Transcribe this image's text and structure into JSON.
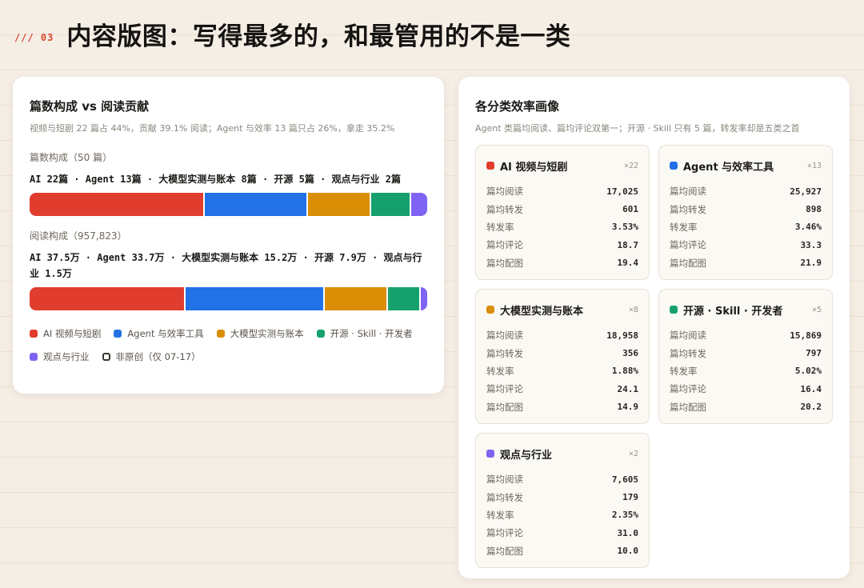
{
  "header": {
    "section_tag": "/// 03",
    "title": "内容版图：写得最多的，和最管用的不是一类"
  },
  "left_card": {
    "title": "篇数构成 vs 阅读贡献",
    "subtitle": "视频与短剧 22 篇占 44%，贡献 39.1% 阅读；Agent 与效率 13 篇只占 26%，拿走 35.2%",
    "count_group": {
      "title": "篇数构成（50 篇）",
      "desc": "AI 22篇 · Agent 13篇 · 大模型实测与账本 8篇 · 开源 5篇 · 观点与行业 2篇",
      "segments": [
        {
          "value": 22,
          "color": "#e03d2f"
        },
        {
          "value": 13,
          "color": "#2271e6"
        },
        {
          "value": 8,
          "color": "#d98e06"
        },
        {
          "value": 5,
          "color": "#16a06d"
        },
        {
          "value": 2,
          "color": "#7f63f2"
        }
      ]
    },
    "read_group": {
      "title": "阅读构成（957,823）",
      "desc": "AI 37.5万 · Agent 33.7万 · 大模型实测与账本 15.2万 · 开源 7.9万 · 观点与行业 1.5万",
      "segments": [
        {
          "value": 37.5,
          "color": "#e03d2f"
        },
        {
          "value": 33.7,
          "color": "#2271e6"
        },
        {
          "value": 15.2,
          "color": "#d98e06"
        },
        {
          "value": 7.9,
          "color": "#16a06d"
        },
        {
          "value": 1.5,
          "color": "#7f63f2"
        }
      ]
    },
    "legend": [
      {
        "label": "AI 视频与短剧",
        "color": "#e03d2f",
        "hollow": false
      },
      {
        "label": "Agent 与效率工具",
        "color": "#2271e6",
        "hollow": false
      },
      {
        "label": "大模型实测与账本",
        "color": "#d98e06",
        "hollow": false
      },
      {
        "label": "开源 · Skill · 开发者",
        "color": "#16a06d",
        "hollow": false
      },
      {
        "label": "观点与行业",
        "color": "#7f63f2",
        "hollow": false
      },
      {
        "label": "非原创（仅 07-17）",
        "color": "#3a3631",
        "hollow": true
      }
    ]
  },
  "right_card": {
    "title": "各分类效率画像",
    "subtitle": "Agent 类篇均阅读、篇均评论双第一；开源 · Skill 只有 5 篇，转发率却是五类之首",
    "categories": [
      {
        "name": "AI 视频与短剧",
        "count": "×22",
        "color": "#e03d2f",
        "stats": [
          {
            "label": "篇均阅读",
            "value": "17,025"
          },
          {
            "label": "篇均转发",
            "value": "601"
          },
          {
            "label": "转发率",
            "value": "3.53%"
          },
          {
            "label": "篇均评论",
            "value": "18.7"
          },
          {
            "label": "篇均配图",
            "value": "19.4"
          }
        ]
      },
      {
        "name": "Agent 与效率工具",
        "count": "×13",
        "color": "#2271e6",
        "stats": [
          {
            "label": "篇均阅读",
            "value": "25,927"
          },
          {
            "label": "篇均转发",
            "value": "898"
          },
          {
            "label": "转发率",
            "value": "3.46%"
          },
          {
            "label": "篇均评论",
            "value": "33.3"
          },
          {
            "label": "篇均配图",
            "value": "21.9"
          }
        ]
      },
      {
        "name": "大模型实测与账本",
        "count": "×8",
        "color": "#d98e06",
        "stats": [
          {
            "label": "篇均阅读",
            "value": "18,958"
          },
          {
            "label": "篇均转发",
            "value": "356"
          },
          {
            "label": "转发率",
            "value": "1.88%"
          },
          {
            "label": "篇均评论",
            "value": "24.1"
          },
          {
            "label": "篇均配图",
            "value": "14.9"
          }
        ]
      },
      {
        "name": "开源 · Skill · 开发者",
        "count": "×5",
        "color": "#16a06d",
        "stats": [
          {
            "label": "篇均阅读",
            "value": "15,869"
          },
          {
            "label": "篇均转发",
            "value": "797"
          },
          {
            "label": "转发率",
            "value": "5.02%"
          },
          {
            "label": "篇均评论",
            "value": "16.4"
          },
          {
            "label": "篇均配图",
            "value": "20.2"
          }
        ]
      },
      {
        "name": "观点与行业",
        "count": "×2",
        "color": "#7f63f2",
        "stats": [
          {
            "label": "篇均阅读",
            "value": "7,605"
          },
          {
            "label": "篇均转发",
            "value": "179"
          },
          {
            "label": "转发率",
            "value": "2.35%"
          },
          {
            "label": "篇均评论",
            "value": "31.0"
          },
          {
            "label": "篇均配图",
            "value": "10.0"
          }
        ]
      }
    ]
  }
}
